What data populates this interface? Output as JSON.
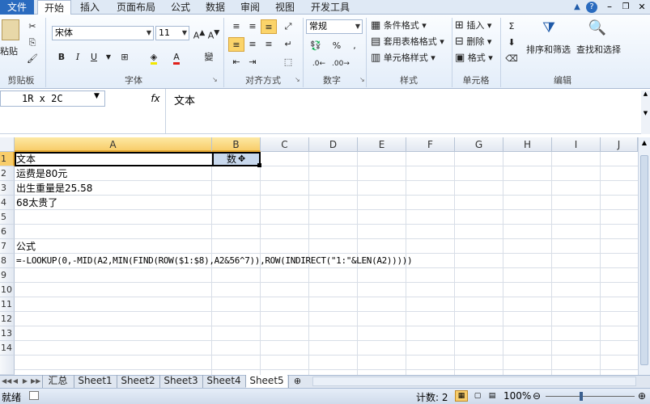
{
  "tabs": [
    "文件",
    "开始",
    "插入",
    "页面布局",
    "公式",
    "数据",
    "审阅",
    "视图",
    "开发工具"
  ],
  "clipboard": {
    "paste": "粘贴",
    "label": "剪贴板"
  },
  "font": {
    "name": "宋体",
    "size": "11",
    "bold": "B",
    "italic": "I",
    "underline": "U",
    "wen": "變",
    "label": "字体"
  },
  "align": {
    "label": "对齐方式"
  },
  "number": {
    "format": "常规",
    "percent": "%",
    "comma": ",",
    "label": "数字"
  },
  "styles": {
    "cond": "条件格式",
    "table": "套用表格格式",
    "cell": "单元格样式",
    "label": "样式"
  },
  "cells": {
    "insert": "插入",
    "delete": "删除",
    "format": "格式",
    "label": "单元格"
  },
  "editing": {
    "sigma": "Σ",
    "sort": "排序和筛选",
    "find": "查找和选择",
    "label": "编辑"
  },
  "namebox": "1R x 2C",
  "fx": "fx",
  "formula_value": "文本",
  "columns": [
    "A",
    "B",
    "C",
    "D",
    "E",
    "F",
    "G",
    "H",
    "I",
    "J"
  ],
  "rows": [
    "1",
    "2",
    "3",
    "4",
    "5",
    "6",
    "7",
    "8",
    "9",
    "10",
    "11",
    "12",
    "13",
    "14"
  ],
  "cells_data": {
    "a1": "文本",
    "b1": "数",
    "a2": "运费是80元",
    "a3": "出生重量是25.58",
    "a4": "68太贵了",
    "a7": "公式",
    "a8": "=-LOOKUP(0,-MID(A2,MIN(FIND(ROW($1:$8),A2&56^7)),ROW(INDIRECT(\"1:\"&LEN(A2)))))"
  },
  "sheets": [
    "汇总",
    "Sheet1",
    "Sheet2",
    "Sheet3",
    "Sheet4",
    "Sheet5"
  ],
  "status": {
    "ready": "就绪",
    "count": "计数: 2",
    "zoom": "100%"
  }
}
